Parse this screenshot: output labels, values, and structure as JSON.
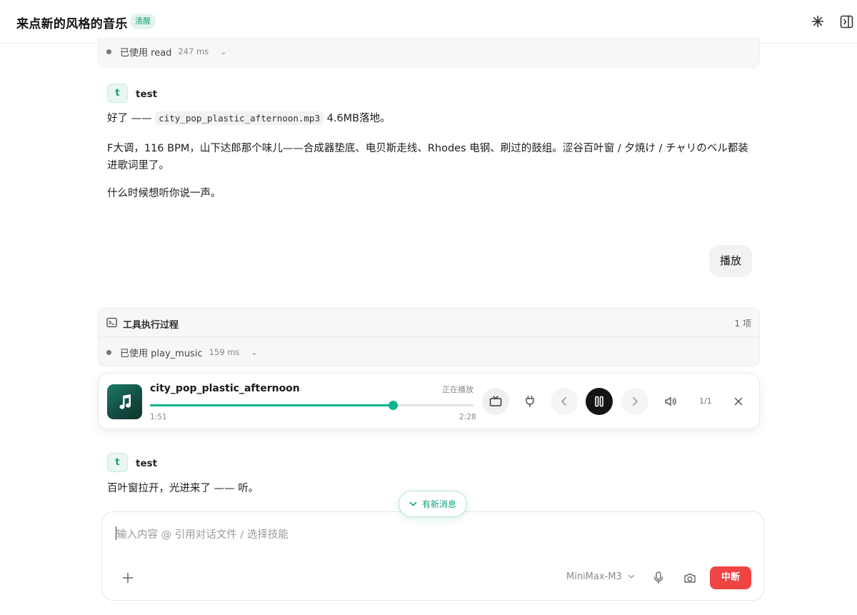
{
  "header": {
    "title": "来点新的风格的音乐",
    "badge": "清醒",
    "icons": [
      "sparkle-icon",
      "sidebar-toggle-icon"
    ]
  },
  "tool_strip_top": {
    "label": "已使用 read",
    "duration": "247 ms"
  },
  "assistant_message_1": {
    "avatar": "t",
    "sender": "test",
    "line1_prefix": "好了 —— ",
    "filename": "city_pop_plastic_afternoon.mp3",
    "line1_suffix": " 4.6MB落地。",
    "paragraph2": "F大调，116 BPM，山下达郎那个味儿——合成器垫底、电贝斯走线、Rhodes 电钢、刷过的鼓组。涩谷百叶窗 / 夕焼け / チャリのベル都装进歌词里了。",
    "paragraph3": "什么时候想听你说一声。"
  },
  "user_message": {
    "text": "播放"
  },
  "tool_panel": {
    "title": "工具执行过程",
    "count": "1 项",
    "label": "已使用 play_music",
    "duration": "159 ms"
  },
  "player": {
    "title": "city_pop_plastic_afternoon",
    "status": "正在播放",
    "elapsed": "1:51",
    "total": "2:28",
    "progress": 0.75,
    "counter": "1/1",
    "accent": "#10b48a"
  },
  "assistant_message_2": {
    "avatar": "t",
    "sender": "test",
    "text": "百叶窗拉开，光进来了 —— 听。"
  },
  "new_messages": {
    "label": "有新消息"
  },
  "composer": {
    "placeholder": "输入内容  @ 引用对话文件  / 选择技能",
    "model": "MiniMax-M3",
    "stop_label": "中断",
    "stop_color": "#ef4444"
  }
}
